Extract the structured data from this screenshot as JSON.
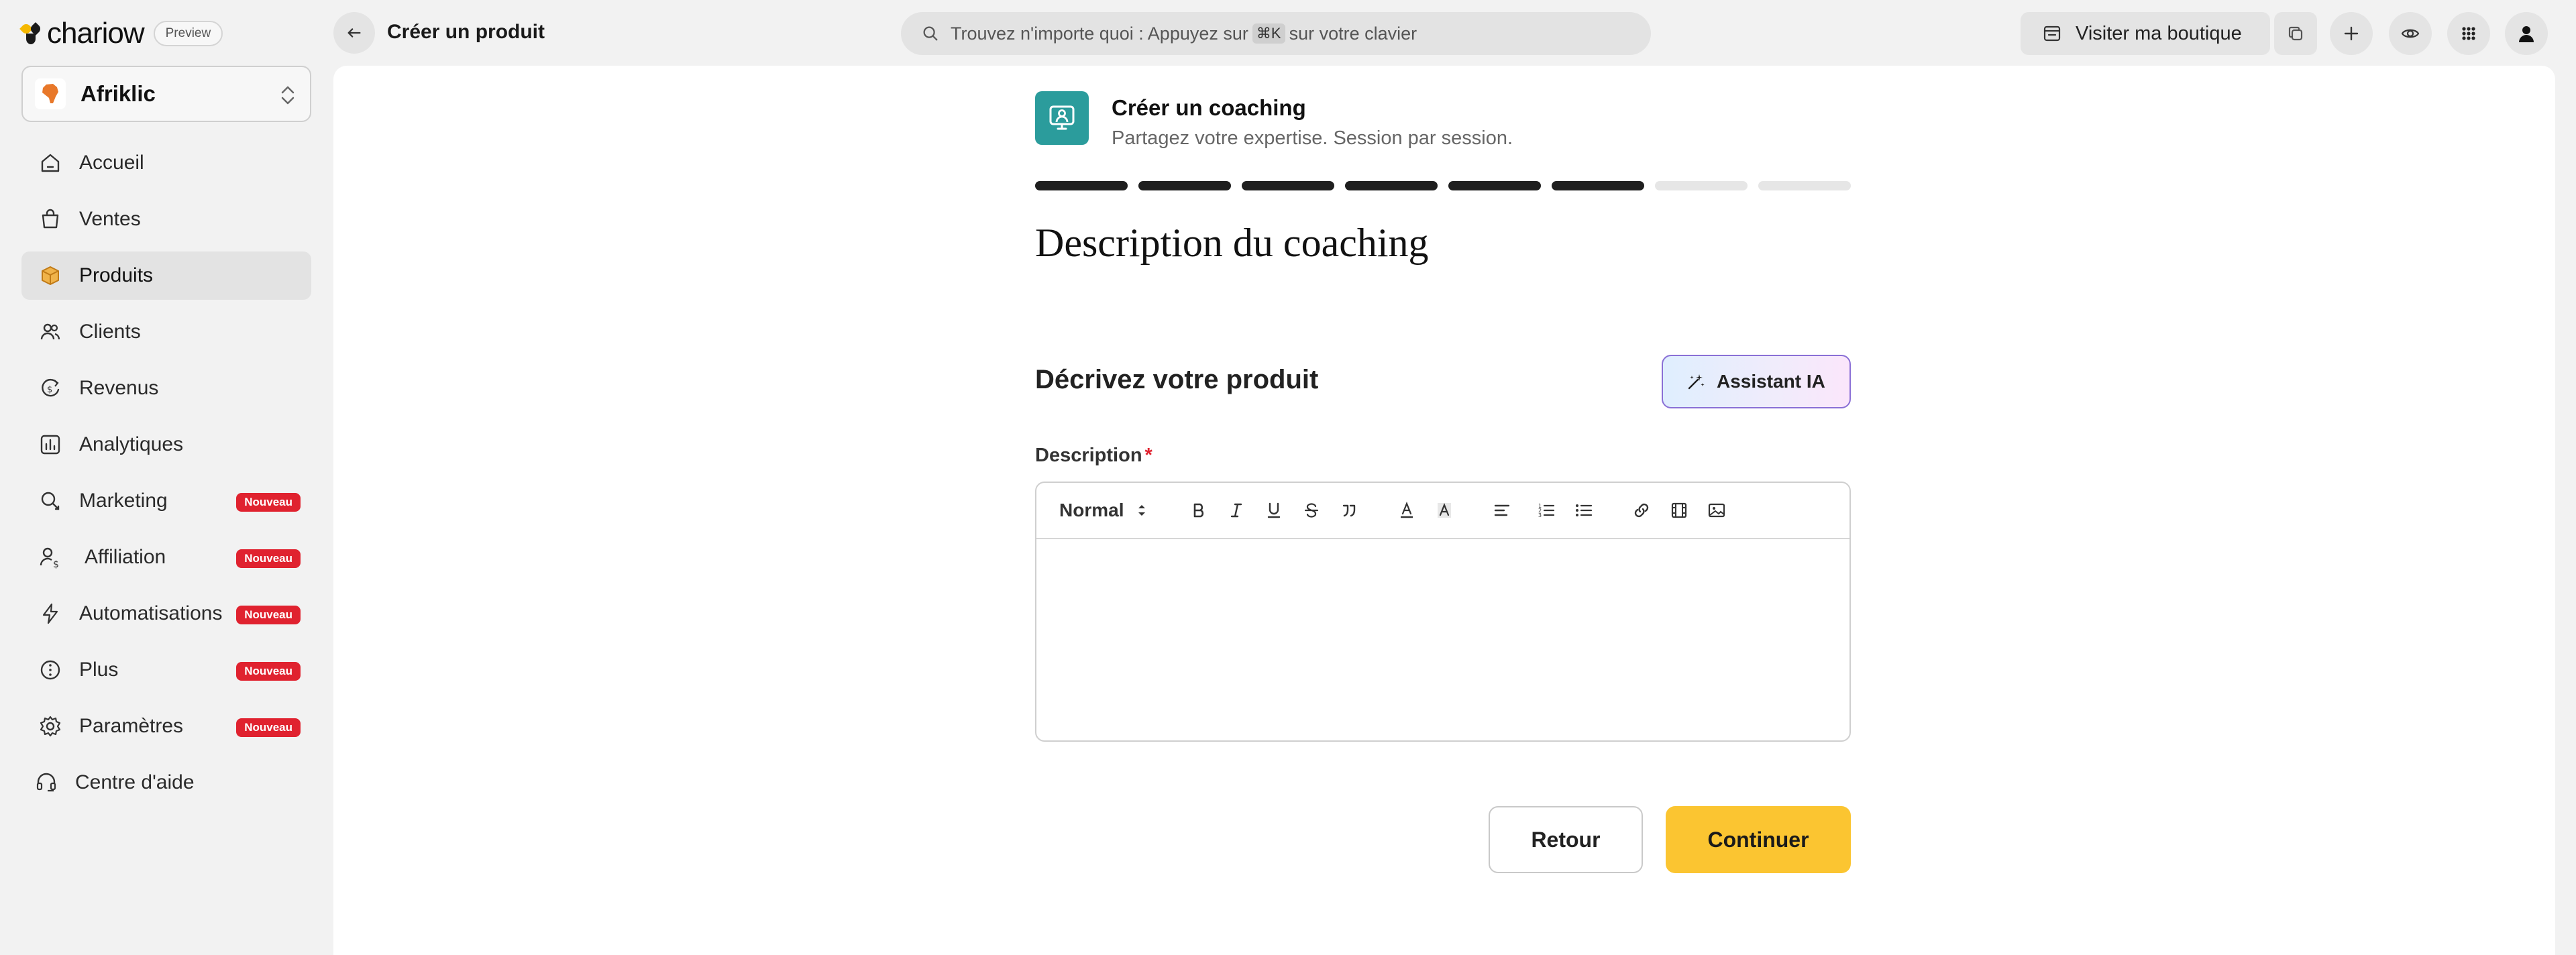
{
  "brand": {
    "name": "chariow",
    "preview_label": "Preview"
  },
  "shop": {
    "name": "Afriklic",
    "avatar_text": "AfriClik"
  },
  "sidebar": {
    "items": [
      {
        "label": "Accueil",
        "icon": "home-icon"
      },
      {
        "label": "Ventes",
        "icon": "shopping-bag-icon"
      },
      {
        "label": "Produits",
        "icon": "box-icon",
        "active": true
      },
      {
        "label": "Clients",
        "icon": "users-icon"
      },
      {
        "label": "Revenus",
        "icon": "dollar-refresh-icon"
      },
      {
        "label": "Analytiques",
        "icon": "bar-chart-icon"
      },
      {
        "label": "Marketing",
        "icon": "megaphone-icon",
        "badge": "Nouveau"
      },
      {
        "label": "Affiliation",
        "icon": "user-dollar-icon",
        "badge": "Nouveau"
      },
      {
        "label": "Automatisations",
        "icon": "bolt-icon",
        "badge": "Nouveau"
      },
      {
        "label": "Plus",
        "icon": "more-icon",
        "badge": "Nouveau"
      },
      {
        "label": "Paramètres",
        "icon": "gear-icon",
        "badge": "Nouveau"
      },
      {
        "label": "Centre d'aide",
        "icon": "headset-icon"
      }
    ]
  },
  "topbar": {
    "title": "Créer un produit",
    "search": {
      "prefix": "Trouvez n'importe quoi : Appuyez sur",
      "shortcut": "⌘K",
      "suffix": "sur votre clavier"
    },
    "visit_label": "Visiter ma boutique"
  },
  "wizard": {
    "title": "Créer un coaching",
    "subtitle": "Partagez votre expertise. Session par session.",
    "progress": {
      "total_steps": 8,
      "completed_steps": 6
    },
    "section_title": "Description du coaching",
    "subsection_title": "Décrivez votre produit",
    "ai_button_label": "Assistant IA",
    "description_label": "Description",
    "required_mark": "*",
    "editor": {
      "format_value": "Normal",
      "content": ""
    },
    "back_label": "Retour",
    "continue_label": "Continuer"
  },
  "colors": {
    "accent": "#fbc531",
    "badge": "#e0222f",
    "coaching": "#2b9c9c",
    "progress_done": "#1f1f1f",
    "progress_todo": "#e6e6e6"
  }
}
